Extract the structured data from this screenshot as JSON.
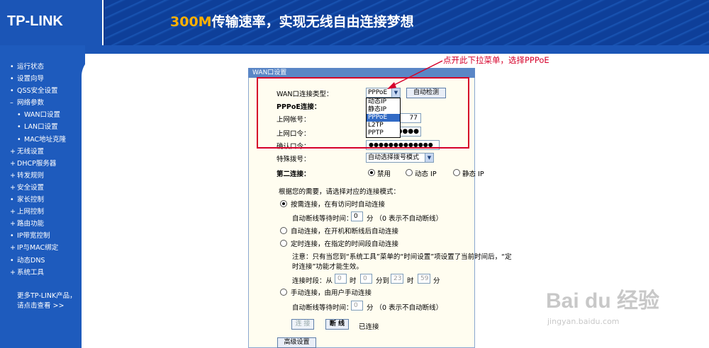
{
  "header": {
    "logo": "TP-LINK",
    "slogan_num": "300M",
    "slogan_text": "传输速率，实现无线自由连接梦想"
  },
  "sidebar": {
    "items": [
      {
        "label": "运行状态",
        "bullet": "•"
      },
      {
        "label": "设置向导",
        "bullet": "•"
      },
      {
        "label": "QSS安全设置",
        "bullet": "•"
      },
      {
        "label": "网络参数",
        "bullet": "–"
      },
      {
        "label": "WAN口设置",
        "bullet": "•"
      },
      {
        "label": "LAN口设置",
        "bullet": "•"
      },
      {
        "label": "MAC地址克隆",
        "bullet": "•"
      },
      {
        "label": "无线设置",
        "bullet": "+"
      },
      {
        "label": "DHCP服务器",
        "bullet": "+"
      },
      {
        "label": "转发规则",
        "bullet": "+"
      },
      {
        "label": "安全设置",
        "bullet": "+"
      },
      {
        "label": "家长控制",
        "bullet": "•"
      },
      {
        "label": "上网控制",
        "bullet": "+"
      },
      {
        "label": "路由功能",
        "bullet": "+"
      },
      {
        "label": "IP带宽控制",
        "bullet": "•"
      },
      {
        "label": "IP与MAC绑定",
        "bullet": "+"
      },
      {
        "label": "动态DNS",
        "bullet": "•"
      },
      {
        "label": "系统工具",
        "bullet": "+"
      }
    ],
    "more_line1": "更多TP-LINK产品，",
    "more_line2": "请点击查看 >>"
  },
  "panel": {
    "title": "WAN口设置",
    "wan_type_label": "WAN口连接类型：",
    "wan_type_value": "PPPoE",
    "auto_detect": "自动检测",
    "pppoe_label": "PPPoE连接：",
    "account_label": "上网帐号：",
    "account_value": "77",
    "password_label": "上网口令：",
    "password_value": "●●●●●",
    "confirm_label": "确认口令：",
    "confirm_value": "●●●●●●●●●●●●●",
    "special_label": "特殊拨号：",
    "special_value": "自动选择拨号模式",
    "second_label": "第二连接：",
    "second_options": [
      "禁用",
      "动态 IP",
      "静态 IP"
    ],
    "mode_intro": "根据您的需要，请选择对应的连接模式：",
    "mode1": "按需连接，在有访问时自动连接",
    "idle1_label": "自动断线等待时间：",
    "idle1_value": "0",
    "idle1_unit": "分 （0 表示不自动断线）",
    "mode2": "自动连接，在开机和断线后自动连接",
    "mode3": "定时连接，在指定的时间段自动连接",
    "note_line1": "注意：只有当您到“系统工具”菜单的“时间设置”项设置了当前时间后，“定",
    "note_line2": "时连接”功能才能生效。",
    "period_label": "连接时段：从",
    "period_from_h": "0",
    "period_from_m": "0",
    "period_to_h": "23",
    "period_to_m": "59",
    "hour_unit": "时",
    "to_unit": "分到",
    "min_unit": "分",
    "mode4": "手动连接，由用户手动连接",
    "idle2_label": "自动断线等待时间：",
    "idle2_value": "0",
    "idle2_unit": "分 （0 表示不自动断线）",
    "connect_btn": "连 接",
    "disconnect_btn": "断 线",
    "status": "已连接",
    "advanced_btn": "高级设置"
  },
  "dropdown": {
    "options": [
      "动态IP",
      "静态IP",
      "PPPoE",
      "L2TP",
      "PPTP"
    ],
    "selected": "PPPoE"
  },
  "annotation": "点开此下拉菜单，选择PPPoE",
  "watermark": {
    "main": "Bai du 经验",
    "sub": "jingyan.baidu.com"
  },
  "colors": {
    "header_bg": "#0b3c8f",
    "sidebar_bg": "#1e5bbd",
    "annotation": "#d6002a",
    "slogan": "#ffc21a"
  }
}
